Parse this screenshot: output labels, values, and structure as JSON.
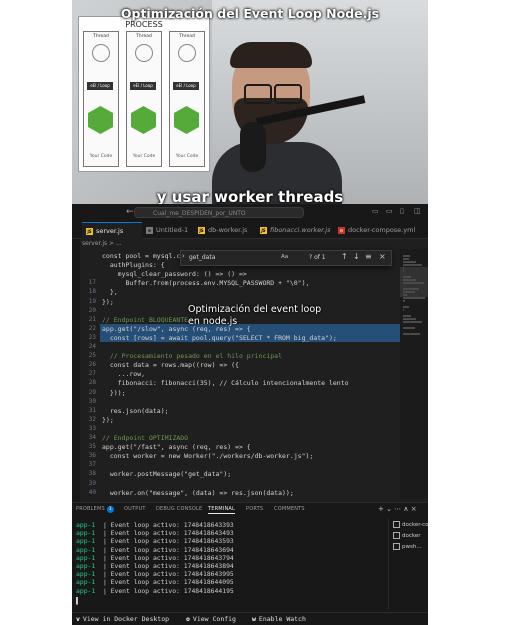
{
  "video": {
    "title": "Optimización del Event Loop Node.js",
    "caption": "y usar worker threads",
    "overlay_note": "Optimización del event loop en node.js"
  },
  "diagram": {
    "title": "PROCESS",
    "columns": [
      {
        "thread": "Thread",
        "event_loop": "eEl / Loop",
        "code": "Your Code"
      },
      {
        "thread": "Thread",
        "event_loop": "eEl / Loop",
        "code": "Your Code"
      },
      {
        "thread": "Thread",
        "event_loop": "eEl / Loop",
        "code": "Your Code"
      }
    ]
  },
  "titlebar": {
    "command_center": "Cual_me_DESPIDEN_por_UNTO"
  },
  "tabs": [
    {
      "label": "server.js",
      "icon": "JS",
      "active": true
    },
    {
      "label": "Untitled-1",
      "icon": "≡",
      "active": false
    },
    {
      "label": "db-worker.js",
      "icon": "JS",
      "active": false
    },
    {
      "label": "fibonacci.worker.js",
      "icon": "JS",
      "active": false
    },
    {
      "label": "docker-compose.yml",
      "icon": "⚙",
      "active": false
    }
  ],
  "breadcrumb": "server.js > ...",
  "find_widget": {
    "query": "get_data",
    "match_toggle": "Aa",
    "result_count": "? of 1"
  },
  "editor": {
    "lines": [
      {
        "n": "",
        "code": "const pool = mysql.cr"
      },
      {
        "n": "",
        "code": "  authPlugins: {"
      },
      {
        "n": "",
        "code": "    mysql_clear_password: () => () =>"
      },
      {
        "n": "17",
        "code": "      Buffer.from(process.env.MYSQL_PASSWORD + \"\\0\"),"
      },
      {
        "n": "18",
        "code": "  },"
      },
      {
        "n": "19",
        "code": "});"
      },
      {
        "n": "20",
        "code": ""
      },
      {
        "n": "21",
        "code": "// Endpoint BLOQUEANTE"
      },
      {
        "n": "22",
        "code": "app.get(\"/slow\", async (req, res) => {"
      },
      {
        "n": "23",
        "code": "  const [rows] = await pool.query(\"SELECT * FROM big_data\");"
      },
      {
        "n": "24",
        "code": ""
      },
      {
        "n": "25",
        "code": "  // Procesamiento pesado en el hilo principal"
      },
      {
        "n": "26",
        "code": "  const data = rows.map((row) => ({"
      },
      {
        "n": "27",
        "code": "    ...row,"
      },
      {
        "n": "28",
        "code": "    fibonacci: fibonacci(35), // Cálculo intencionalmente lento"
      },
      {
        "n": "29",
        "code": "  }));"
      },
      {
        "n": "30",
        "code": ""
      },
      {
        "n": "31",
        "code": "  res.json(data);"
      },
      {
        "n": "32",
        "code": "});"
      },
      {
        "n": "33",
        "code": ""
      },
      {
        "n": "34",
        "code": "// Endpoint OPTIMIZADO"
      },
      {
        "n": "35",
        "code": "app.get(\"/fast\", async (req, res) => {"
      },
      {
        "n": "36",
        "code": "  const worker = new Worker(\"./workers/db-worker.js\");"
      },
      {
        "n": "37",
        "code": ""
      },
      {
        "n": "38",
        "code": "  worker.postMessage(\"get_data\");"
      },
      {
        "n": "39",
        "code": ""
      },
      {
        "n": "40",
        "code": "  worker.on(\"message\", (data) => res.json(data));"
      }
    ]
  },
  "panel": {
    "tabs": [
      {
        "label": "PROBLEMS",
        "badge": "1",
        "active": false
      },
      {
        "label": "OUTPUT",
        "active": false
      },
      {
        "label": "DEBUG CONSOLE",
        "active": false
      },
      {
        "label": "TERMINAL",
        "active": true
      },
      {
        "label": "PORTS",
        "active": false
      },
      {
        "label": "COMMENTS",
        "active": false
      }
    ],
    "actions": "+ ⌄  ⋯  ∧  ×",
    "terminal_lines": [
      {
        "app": "app-1",
        "text": "Event loop activo: 1748418643393"
      },
      {
        "app": "app-1",
        "text": "Event loop activo: 1748418643493"
      },
      {
        "app": "app-1",
        "text": "Event loop activo: 1748418643593"
      },
      {
        "app": "app-1",
        "text": "Event loop activo: 1748418643694"
      },
      {
        "app": "app-1",
        "text": "Event loop activo: 1748418643794"
      },
      {
        "app": "app-1",
        "text": "Event loop activo: 1748418643894"
      },
      {
        "app": "app-1",
        "text": "Event loop activo: 1748418643995"
      },
      {
        "app": "app-1",
        "text": "Event loop activo: 1748418644095"
      },
      {
        "app": "app-1",
        "text": "Event loop activo: 1748418644195"
      }
    ],
    "terminal_list": [
      "docker-co...",
      "docker",
      "pwsh..."
    ]
  },
  "footer": [
    {
      "key": "v",
      "label": "View in Docker Desktop"
    },
    {
      "key": "o",
      "label": "View Config"
    },
    {
      "key": "w",
      "label": "Enable Watch"
    }
  ]
}
